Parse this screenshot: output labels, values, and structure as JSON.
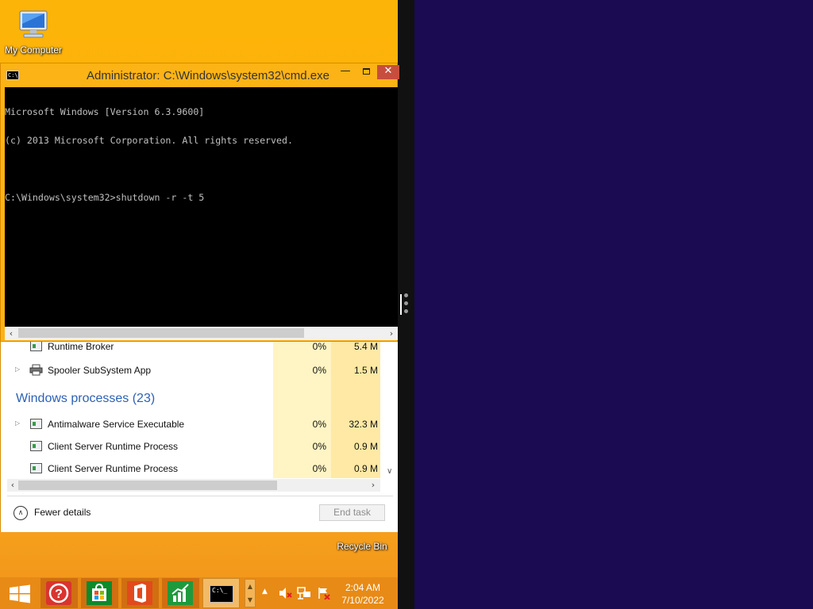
{
  "desktop": {
    "icons": {
      "my_computer": "My Computer",
      "recycle_bin": "Recycle Bin"
    }
  },
  "cmd_window": {
    "title": "Administrator: C:\\Windows\\system32\\cmd.exe",
    "icon": "cmd-icon",
    "buttons": {
      "minimize": "—",
      "maximize": "",
      "close": "✕"
    },
    "console_lines": [
      "Microsoft Windows [Version 6.3.9600]",
      "(c) 2013 Microsoft Corporation. All rights reserved.",
      "",
      "C:\\Windows\\system32>shutdown -r -t 5"
    ]
  },
  "task_manager": {
    "rows": [
      {
        "name": "Runtime Broker",
        "cpu": "0%",
        "memory": "5.4 M"
      },
      {
        "name": "Spooler SubSystem App",
        "cpu": "0%",
        "memory": "1.5 M"
      }
    ],
    "group_header": "Windows processes (23)",
    "windows_rows": [
      {
        "name": "Antimalware Service Executable",
        "cpu": "0%",
        "memory": "32.3 M"
      },
      {
        "name": "Client Server Runtime Process",
        "cpu": "0%",
        "memory": "0.9 M"
      },
      {
        "name": "Client Server Runtime Process",
        "cpu": "0%",
        "memory": "0.9 M"
      }
    ],
    "fewer_details": "Fewer details",
    "end_task": "End task"
  },
  "taskbar": {
    "apps": [
      "help-icon",
      "store-icon",
      "office-icon",
      "finance-icon",
      "cmd-icon"
    ],
    "cmd_tile_text": "C:\\_",
    "clock": {
      "time": "2:04 AM",
      "date": "7/10/2022"
    }
  },
  "colors": {
    "desktop_accent": "#fbaf0e",
    "taskbar": "#e88a16",
    "right_background": "#1b0b53",
    "group_header": "#2c61b5"
  }
}
